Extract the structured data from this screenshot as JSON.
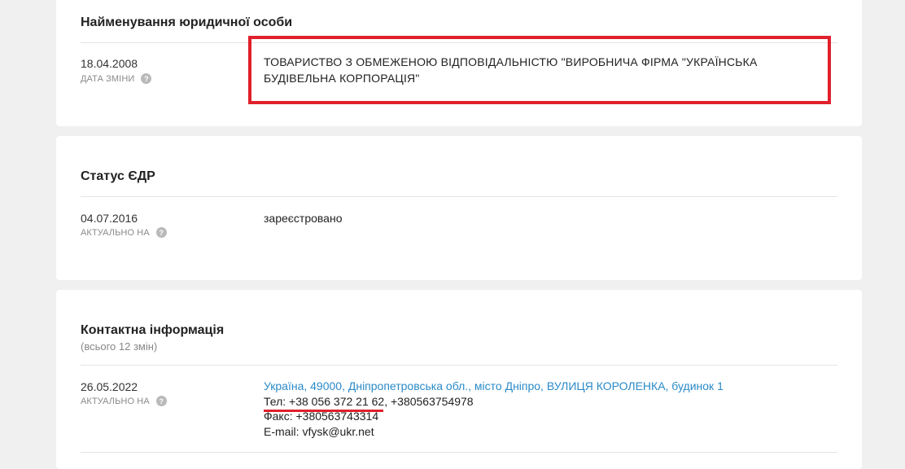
{
  "legal_name": {
    "title": "Найменування юридичної особи",
    "date": "18.04.2008",
    "date_label": "ДАТА ЗМІНИ",
    "value": "ТОВАРИСТВО З ОБМЕЖЕНОЮ ВІДПОВІДАЛЬНІСТЮ \"ВИРОБНИЧА ФІРМА \"УКРАЇНСЬКА БУДІВЕЛЬНА КОРПОРАЦІЯ\""
  },
  "status": {
    "title": "Статус ЄДР",
    "date": "04.07.2016",
    "date_label": "АКТУАЛЬНО НА",
    "value": "зареєстровано"
  },
  "contacts": {
    "title": "Контактна інформація",
    "subtitle": "(всього 12 змін)",
    "date": "26.05.2022",
    "date_label": "АКТУАЛЬНО НА",
    "address": "Україна, 49000, Дніпропетровська обл., місто Дніпро, ВУЛИЦЯ КОРОЛЕНКА, будинок 1",
    "phone_primary": "Тел: +38 056 372 21 62",
    "phone_secondary": ", +380563754978",
    "fax": "Факс: +380563743314",
    "email": "E-mail: vfysk@ukr.net"
  },
  "help_glyph": "?",
  "colors": {
    "highlight": "#e0202b",
    "link": "#2a8ac8",
    "background": "#f0f0f0"
  }
}
